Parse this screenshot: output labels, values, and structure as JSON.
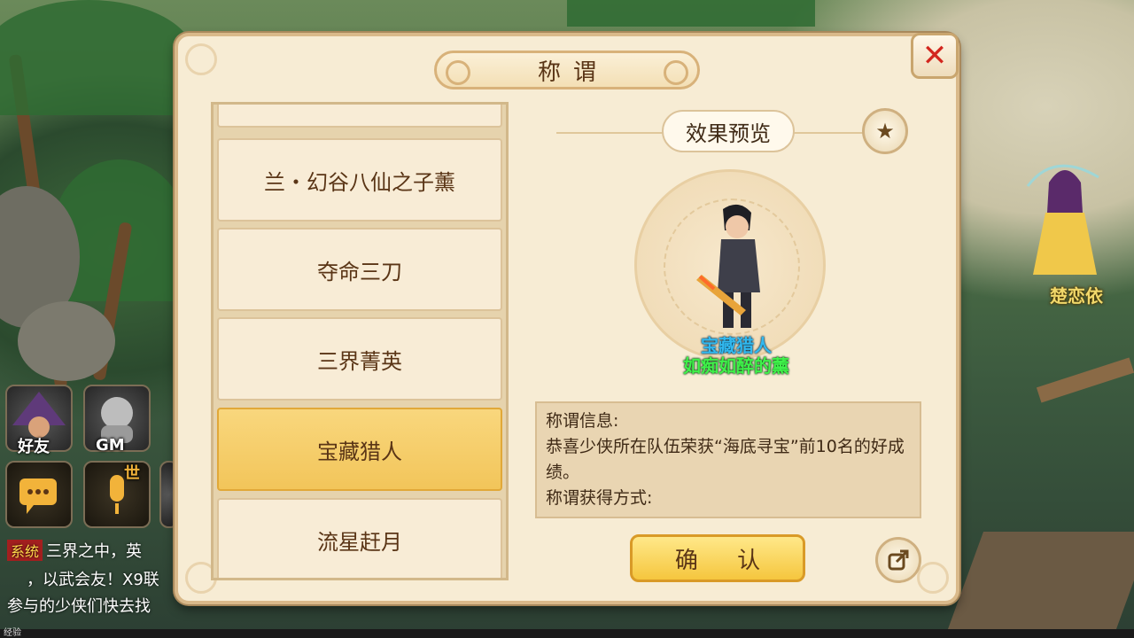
{
  "dialog": {
    "title": "称谓",
    "close_glyph": "✕",
    "titles_list": [
      {
        "label": "",
        "selected": false
      },
      {
        "label": "兰・幻谷八仙之子薰",
        "selected": false
      },
      {
        "label": "夺命三刀",
        "selected": false
      },
      {
        "label": "三界菁英",
        "selected": false
      },
      {
        "label": "宝藏猎人",
        "selected": true
      },
      {
        "label": "流星赶月",
        "selected": false
      }
    ],
    "preview": {
      "label": "效果预览",
      "star_icon": "star-icon",
      "character_title": "宝藏猎人",
      "character_name": "如痴如醉的薰"
    },
    "info": {
      "header": "称谓信息:",
      "description": "恭喜少侠所在队伍荣获“海底寻宝”前10名的好成绩。",
      "acquire_label": "称谓获得方式:"
    },
    "confirm_label": "确 认",
    "share_icon": "share-icon"
  },
  "hud": {
    "friends_label": "好友",
    "gm_label": "GM",
    "world_label": "世",
    "exp_label": "经验"
  },
  "chat": {
    "system_tag": "系统",
    "line1": "三界之中，英",
    "line2": "，以武会友！X9联",
    "line3": "参与的少侠们快去找"
  },
  "npc": {
    "name": "楚恋依"
  },
  "colors": {
    "selected_item": "#f2c55a",
    "close_red": "#d3261e",
    "title_cyan": "#31b9f0",
    "name_green": "#3ff14a"
  }
}
